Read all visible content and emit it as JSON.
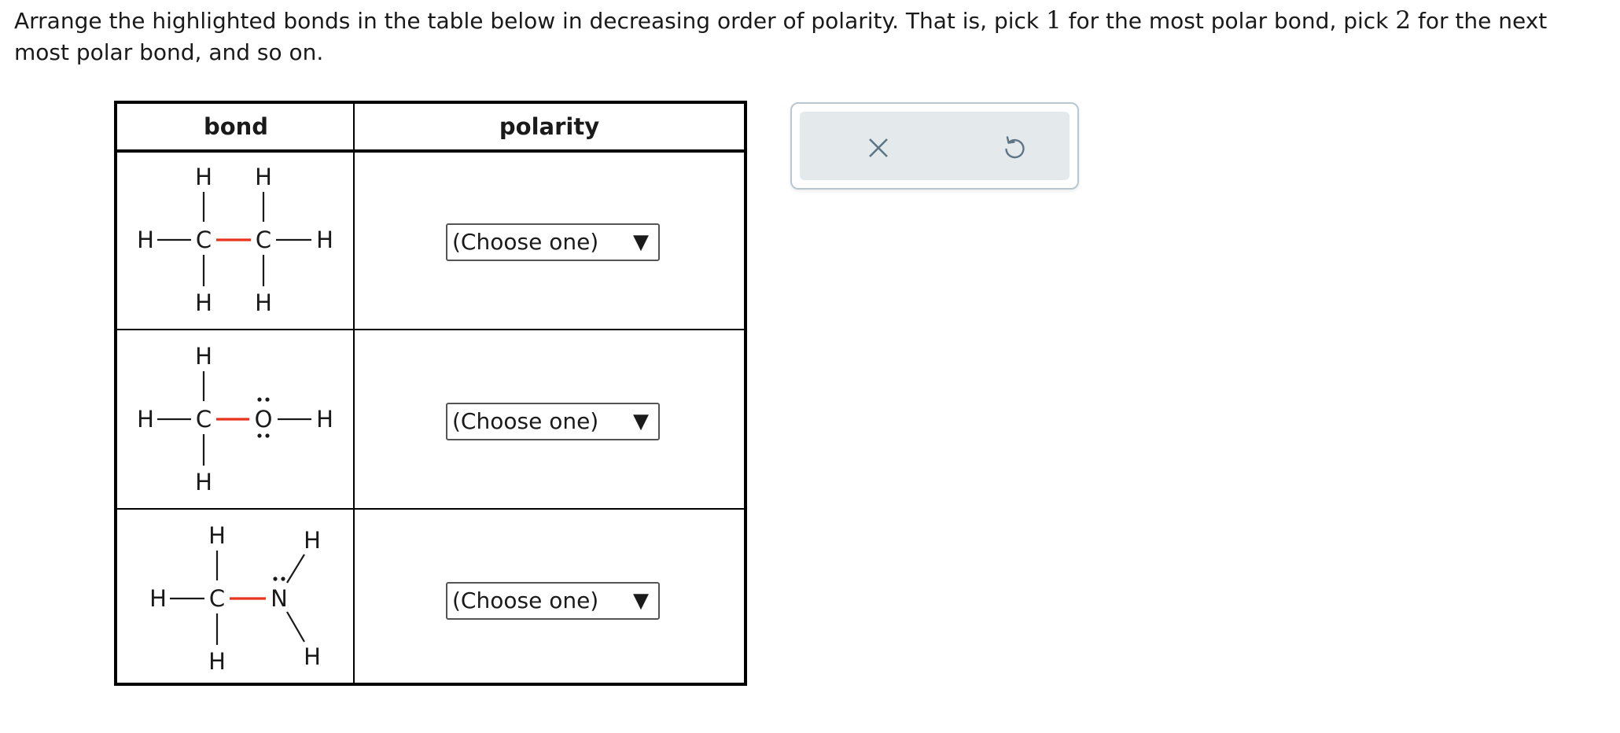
{
  "question": {
    "part1": "Arrange the highlighted bonds in the table below in decreasing order of polarity. That is, pick ",
    "num1": "1",
    "part2": " for the most polar bond, pick ",
    "num2": "2",
    "part3": " for the next most polar bond, and so on."
  },
  "table": {
    "col_bond": "bond",
    "col_polarity": "polarity"
  },
  "rows": [
    {
      "atoms": {
        "h_top1": "H",
        "h_top2": "H",
        "h_left": "H",
        "c1": "C",
        "c2": "C",
        "h_right": "H",
        "h_bot1": "H",
        "h_bot2": "H"
      },
      "select": "(Choose one)"
    },
    {
      "atoms": {
        "h_top": "H",
        "h_left": "H",
        "c": "C",
        "o": "O",
        "h_right": "H",
        "h_bot": "H"
      },
      "select": "(Choose one)"
    },
    {
      "atoms": {
        "h_top": "H",
        "h_left": "H",
        "c": "C",
        "n": "N",
        "h_upper_right": "H",
        "h_lower_right": "H",
        "h_bot": "H"
      },
      "select": "(Choose one)"
    }
  ],
  "select_arrow": "▼",
  "toolbar": {
    "clear_icon": "x-icon",
    "undo_icon": "undo-icon"
  },
  "colors": {
    "highlight_bond": "#e8331e",
    "toolbar_bg": "#e4e9ec",
    "toolbar_border": "#b9c7cf",
    "icon": "#5d7584"
  }
}
